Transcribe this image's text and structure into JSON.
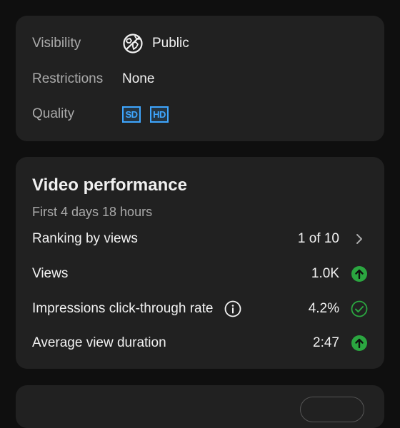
{
  "details": {
    "visibility_label": "Visibility",
    "visibility_value": "Public",
    "restrictions_label": "Restrictions",
    "restrictions_value": "None",
    "quality_label": "Quality",
    "quality_badges": [
      "SD",
      "HD"
    ]
  },
  "performance": {
    "title": "Video performance",
    "subtitle": "First 4 days 18 hours",
    "ranking_label": "Ranking by views",
    "ranking_value": "1 of 10",
    "views_label": "Views",
    "views_value": "1.0K",
    "ctr_label": "Impressions click-through rate",
    "ctr_value": "4.2%",
    "avd_label": "Average view duration",
    "avd_value": "2:47"
  },
  "colors": {
    "card": "#212121",
    "background": "#0f0f0f",
    "accent_blue": "#3ea6ff",
    "positive_green": "#2ba640"
  }
}
